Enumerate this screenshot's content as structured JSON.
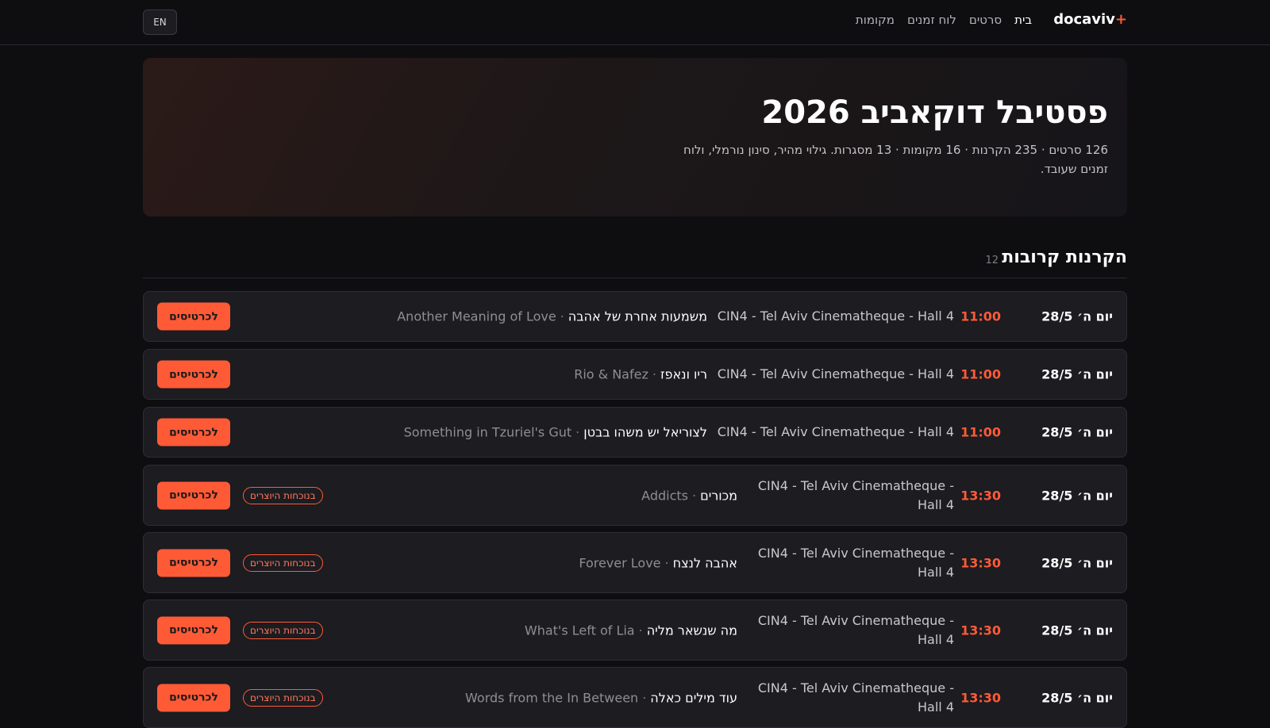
{
  "nav": {
    "brand": "docaviv",
    "brand_plus": "+",
    "links": [
      "בית",
      "סרטים",
      "לוח זמנים",
      "מקומות"
    ],
    "active_index": 0,
    "lang_button": "EN"
  },
  "hero": {
    "title": "פסטיבל דוקאביב 2026",
    "subtitle": "126 סרטים · 235 הקרנות · 16 מקומות · 13 מסגרות. גילוי מהיר, סינון נורמלי, ולוח זמנים שעובד."
  },
  "section": {
    "title": "הקרנות קרובות",
    "count": "12"
  },
  "colors": {
    "accent": "#ff5a36",
    "background": "#0e0e11",
    "card": "#1c1c21"
  },
  "screenings": [
    {
      "date": "יום ה׳ 28/5",
      "time": "11:00",
      "venue": "CIN4 - Tel Aviv Cinematheque - Hall 4",
      "title_he": "משמעות אחרת של אהבה",
      "sep": "·",
      "title_en": "Another Meaning of Love",
      "badge": "",
      "button": "לכרטיסים"
    },
    {
      "date": "יום ה׳ 28/5",
      "time": "11:00",
      "venue": "CIN4 - Tel Aviv Cinematheque - Hall 4",
      "title_he": "ריו ונאפז",
      "sep": "·",
      "title_en": "Rio & Nafez",
      "badge": "",
      "button": "לכרטיסים"
    },
    {
      "date": "יום ה׳ 28/5",
      "time": "11:00",
      "venue": "CIN4 - Tel Aviv Cinematheque - Hall 4",
      "title_he": "לצוריאל יש משהו בבטן",
      "sep": "·",
      "title_en": "Something in Tzuriel's Gut",
      "badge": "",
      "button": "לכרטיסים"
    },
    {
      "date": "יום ה׳ 28/5",
      "time": "13:30",
      "venue": "CIN4 - Tel Aviv Cinematheque - Hall 4",
      "title_he": "מכורים",
      "sep": "·",
      "title_en": "Addicts",
      "badge": "בנוכחות היוצרים",
      "button": "לכרטיסים"
    },
    {
      "date": "יום ה׳ 28/5",
      "time": "13:30",
      "venue": "CIN4 - Tel Aviv Cinematheque - Hall 4",
      "title_he": "אהבה לנצח",
      "sep": "·",
      "title_en": "Forever Love",
      "badge": "בנוכחות היוצרים",
      "button": "לכרטיסים"
    },
    {
      "date": "יום ה׳ 28/5",
      "time": "13:30",
      "venue": "CIN4 - Tel Aviv Cinematheque - Hall 4",
      "title_he": "מה שנשאר מליה",
      "sep": "·",
      "title_en": "What's Left of Lia",
      "badge": "בנוכחות היוצרים",
      "button": "לכרטיסים"
    },
    {
      "date": "יום ה׳ 28/5",
      "time": "13:30",
      "venue": "CIN4 - Tel Aviv Cinematheque - Hall 4",
      "title_he": "עוד מילים כאלה",
      "sep": "·",
      "title_en": "Words from the In Between",
      "badge": "בנוכחות היוצרים",
      "button": "לכרטיסים"
    }
  ]
}
